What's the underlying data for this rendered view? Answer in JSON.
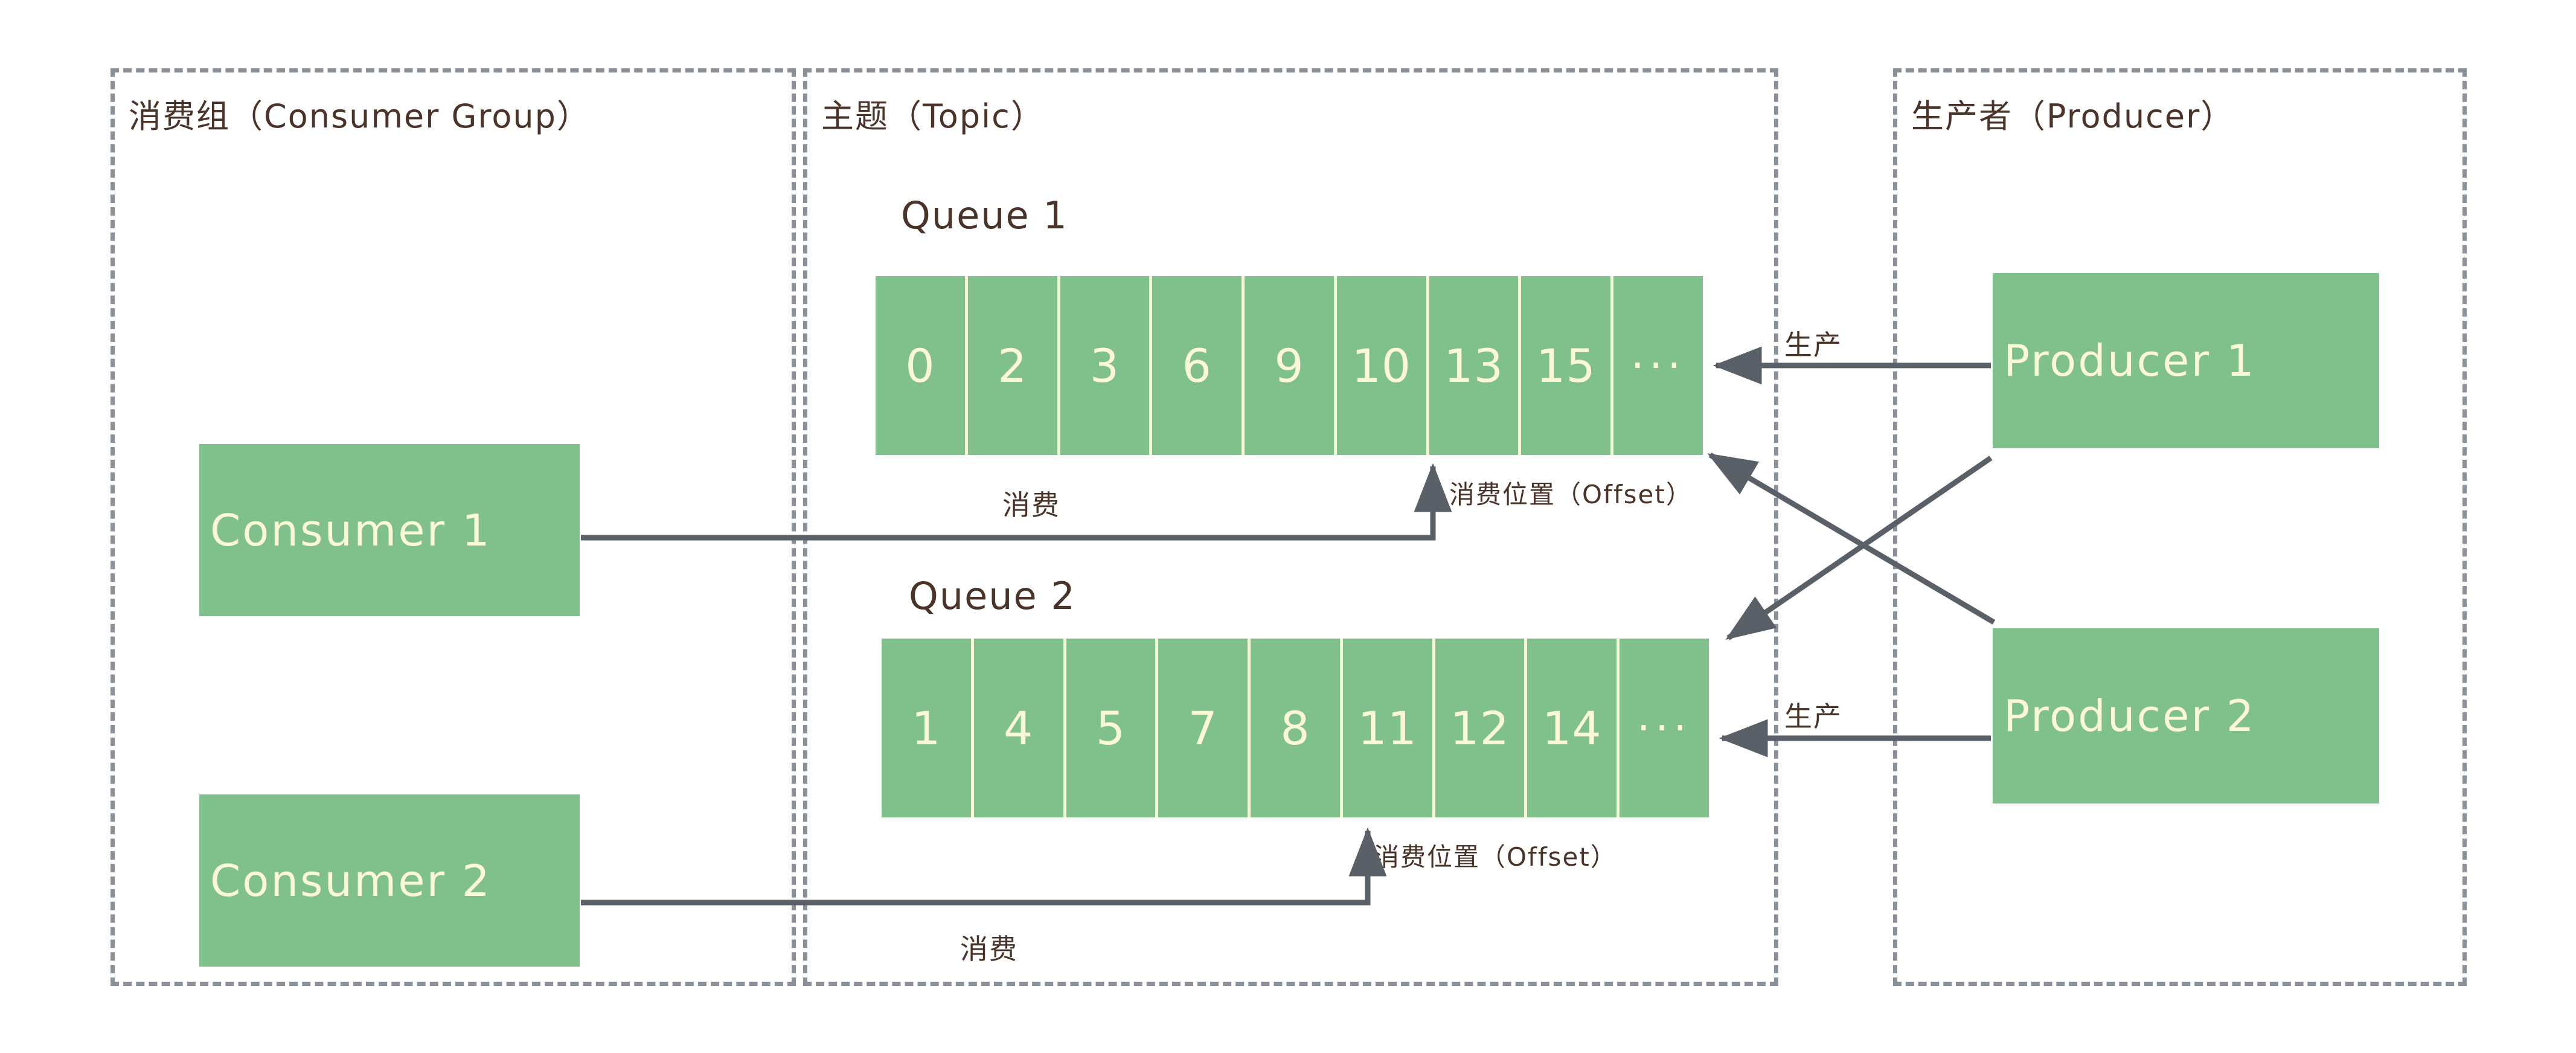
{
  "panels": [
    {
      "id": "consumer-group",
      "title": "消费组（Consumer Group）"
    },
    {
      "id": "topic",
      "title": "主题（Topic）"
    },
    {
      "id": "producer",
      "title": "生产者（Producer）"
    }
  ],
  "consumers": [
    {
      "label": "Consumer 1"
    },
    {
      "label": "Consumer 2"
    }
  ],
  "producers": [
    {
      "label": "Producer 1"
    },
    {
      "label": "Producer 2"
    }
  ],
  "queues": [
    {
      "label": "Queue 1",
      "cells": [
        "0",
        "2",
        "3",
        "6",
        "9",
        "10",
        "13",
        "15",
        "···"
      ],
      "offset_label": "消费位置（Offset）",
      "consume_label": "消费",
      "produce_label": "生产"
    },
    {
      "label": "Queue 2",
      "cells": [
        "1",
        "4",
        "5",
        "7",
        "8",
        "11",
        "12",
        "14",
        "···"
      ],
      "offset_label": "消费位置（Offset）",
      "consume_label": "消费",
      "produce_label": "生产"
    }
  ],
  "colors": {
    "green": "#7fc08c",
    "cream": "#fbf8d6",
    "cell_divider": "#f4f6d8",
    "text_dark": "#4a3328",
    "line": "#5a6068",
    "panel_border": "#8a9199",
    "background": "#ffffff"
  }
}
